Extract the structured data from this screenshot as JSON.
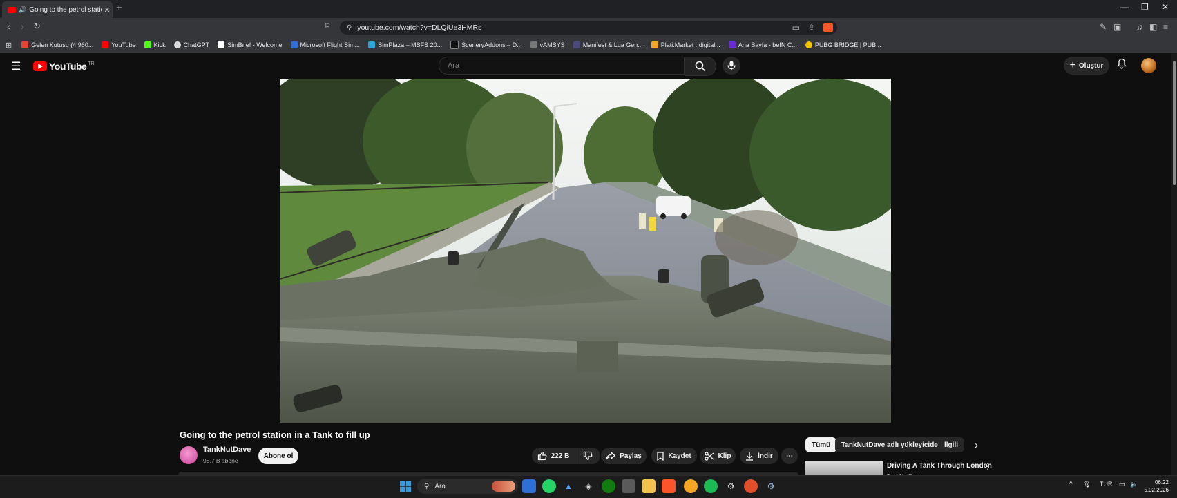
{
  "browser": {
    "tab_title": "Going to the petrol station in a Tank to fill up",
    "new_tab": "+",
    "url": "youtube.com/watch?v=DLQiUe3HMRs",
    "bookmarks": [
      {
        "label": "Gelen Kutusu (4.960...",
        "color": "#ea4335"
      },
      {
        "label": "YouTube",
        "color": "#ff0000"
      },
      {
        "label": "Kick",
        "color": "#53fc18"
      },
      {
        "label": "ChatGPT",
        "color": "#d9d9d9"
      },
      {
        "label": "SimBrief - Welcome",
        "color": "#ffffff"
      },
      {
        "label": "Microsoft Flight Sim...",
        "color": "#2f6bd8"
      },
      {
        "label": "SimPlaza – MSFS 20...",
        "color": "#2aa6d9"
      },
      {
        "label": "SceneryAddons – D...",
        "color": "#111111"
      },
      {
        "label": "vAMSYS",
        "color": "#777777"
      },
      {
        "label": "Manifest & Lua Gen...",
        "color": "#4b4a7a"
      },
      {
        "label": "Plati.Market : digital...",
        "color": "#f5a623"
      },
      {
        "label": "Ana Sayfa - beIN C...",
        "color": "#6c2bd9"
      },
      {
        "label": "PUBG BRIDGE | PUB...",
        "color": "#f2c200"
      }
    ]
  },
  "youtube": {
    "logo_text": "YouTube",
    "region": "TR",
    "search_placeholder": "Ara",
    "create_label": "Oluştur"
  },
  "video": {
    "title": "Going to the petrol station in a Tank to fill up",
    "channel": "TankNutDave",
    "subscribers": "98,7 B abone",
    "subscribe_label": "Abone ol",
    "likes": "222 B",
    "share_label": "Paylaş",
    "save_label": "Kaydet",
    "clip_label": "Klip",
    "download_label": "İndir"
  },
  "related": {
    "chips": [
      "Tümü",
      "TankNutDave adlı yükleyiciden",
      "İlgili"
    ],
    "first_title": "Driving A Tank Through London",
    "first_channel": "TankNutDave"
  },
  "taskbar": {
    "search": "Ara",
    "lang": "TUR",
    "time": "06:22",
    "date": "5.02.2026"
  }
}
